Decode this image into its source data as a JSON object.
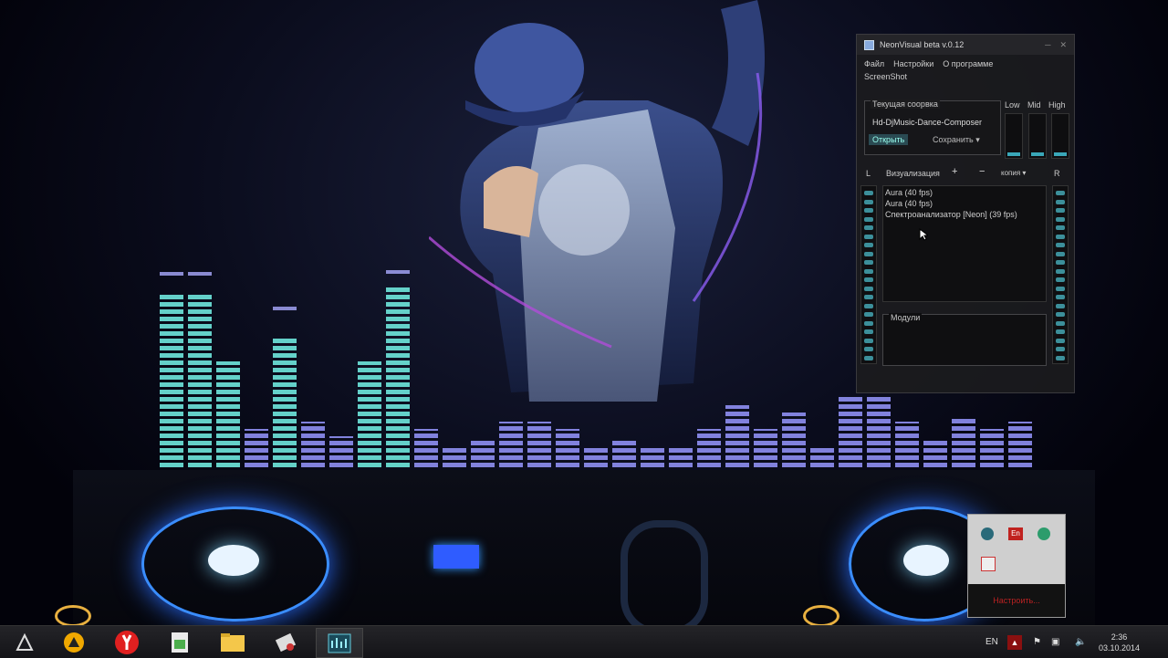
{
  "desktop": {
    "wallpaper_icon": "dj-dancer-wallpaper",
    "colors": {
      "accent": "#3aa7b8",
      "eq_cyan": "#6ee6dc",
      "eq_purple": "#9696ff"
    }
  },
  "player": {
    "title": "NeonVisual beta v.0.12",
    "menu": [
      "Файл",
      "Настройки",
      "О программе"
    ],
    "menu2": "ScreenShot",
    "current_composition": {
      "label": "Текущая соорвка",
      "value": "Hd-DjMusic-Dance-Composer",
      "open_label": "Открыть",
      "save_label": "Сохранить"
    },
    "eq": {
      "low": "Low",
      "mid": "Mid",
      "high": "High"
    },
    "visualization": {
      "left_label": "L",
      "right_label": "R",
      "label": "Визуализация",
      "add": "+",
      "remove": "−",
      "copy": "копия",
      "items": [
        "Aura (40 fps)",
        "Aura (40 fps)",
        "Спектроанализатор [Neon] (39 fps)"
      ]
    },
    "modules_label": "Модули"
  },
  "tray_popup": {
    "settings_label": "Настроить..."
  },
  "taskbar": {
    "apps": [
      "start-icon",
      "aimp-icon",
      "yandex-browser-icon",
      "image-viewer-icon",
      "file-explorer-icon",
      "tool-icon",
      "neonvisual-icon"
    ],
    "language": "EN",
    "time": "2:36",
    "date": "03.10.2014"
  }
}
